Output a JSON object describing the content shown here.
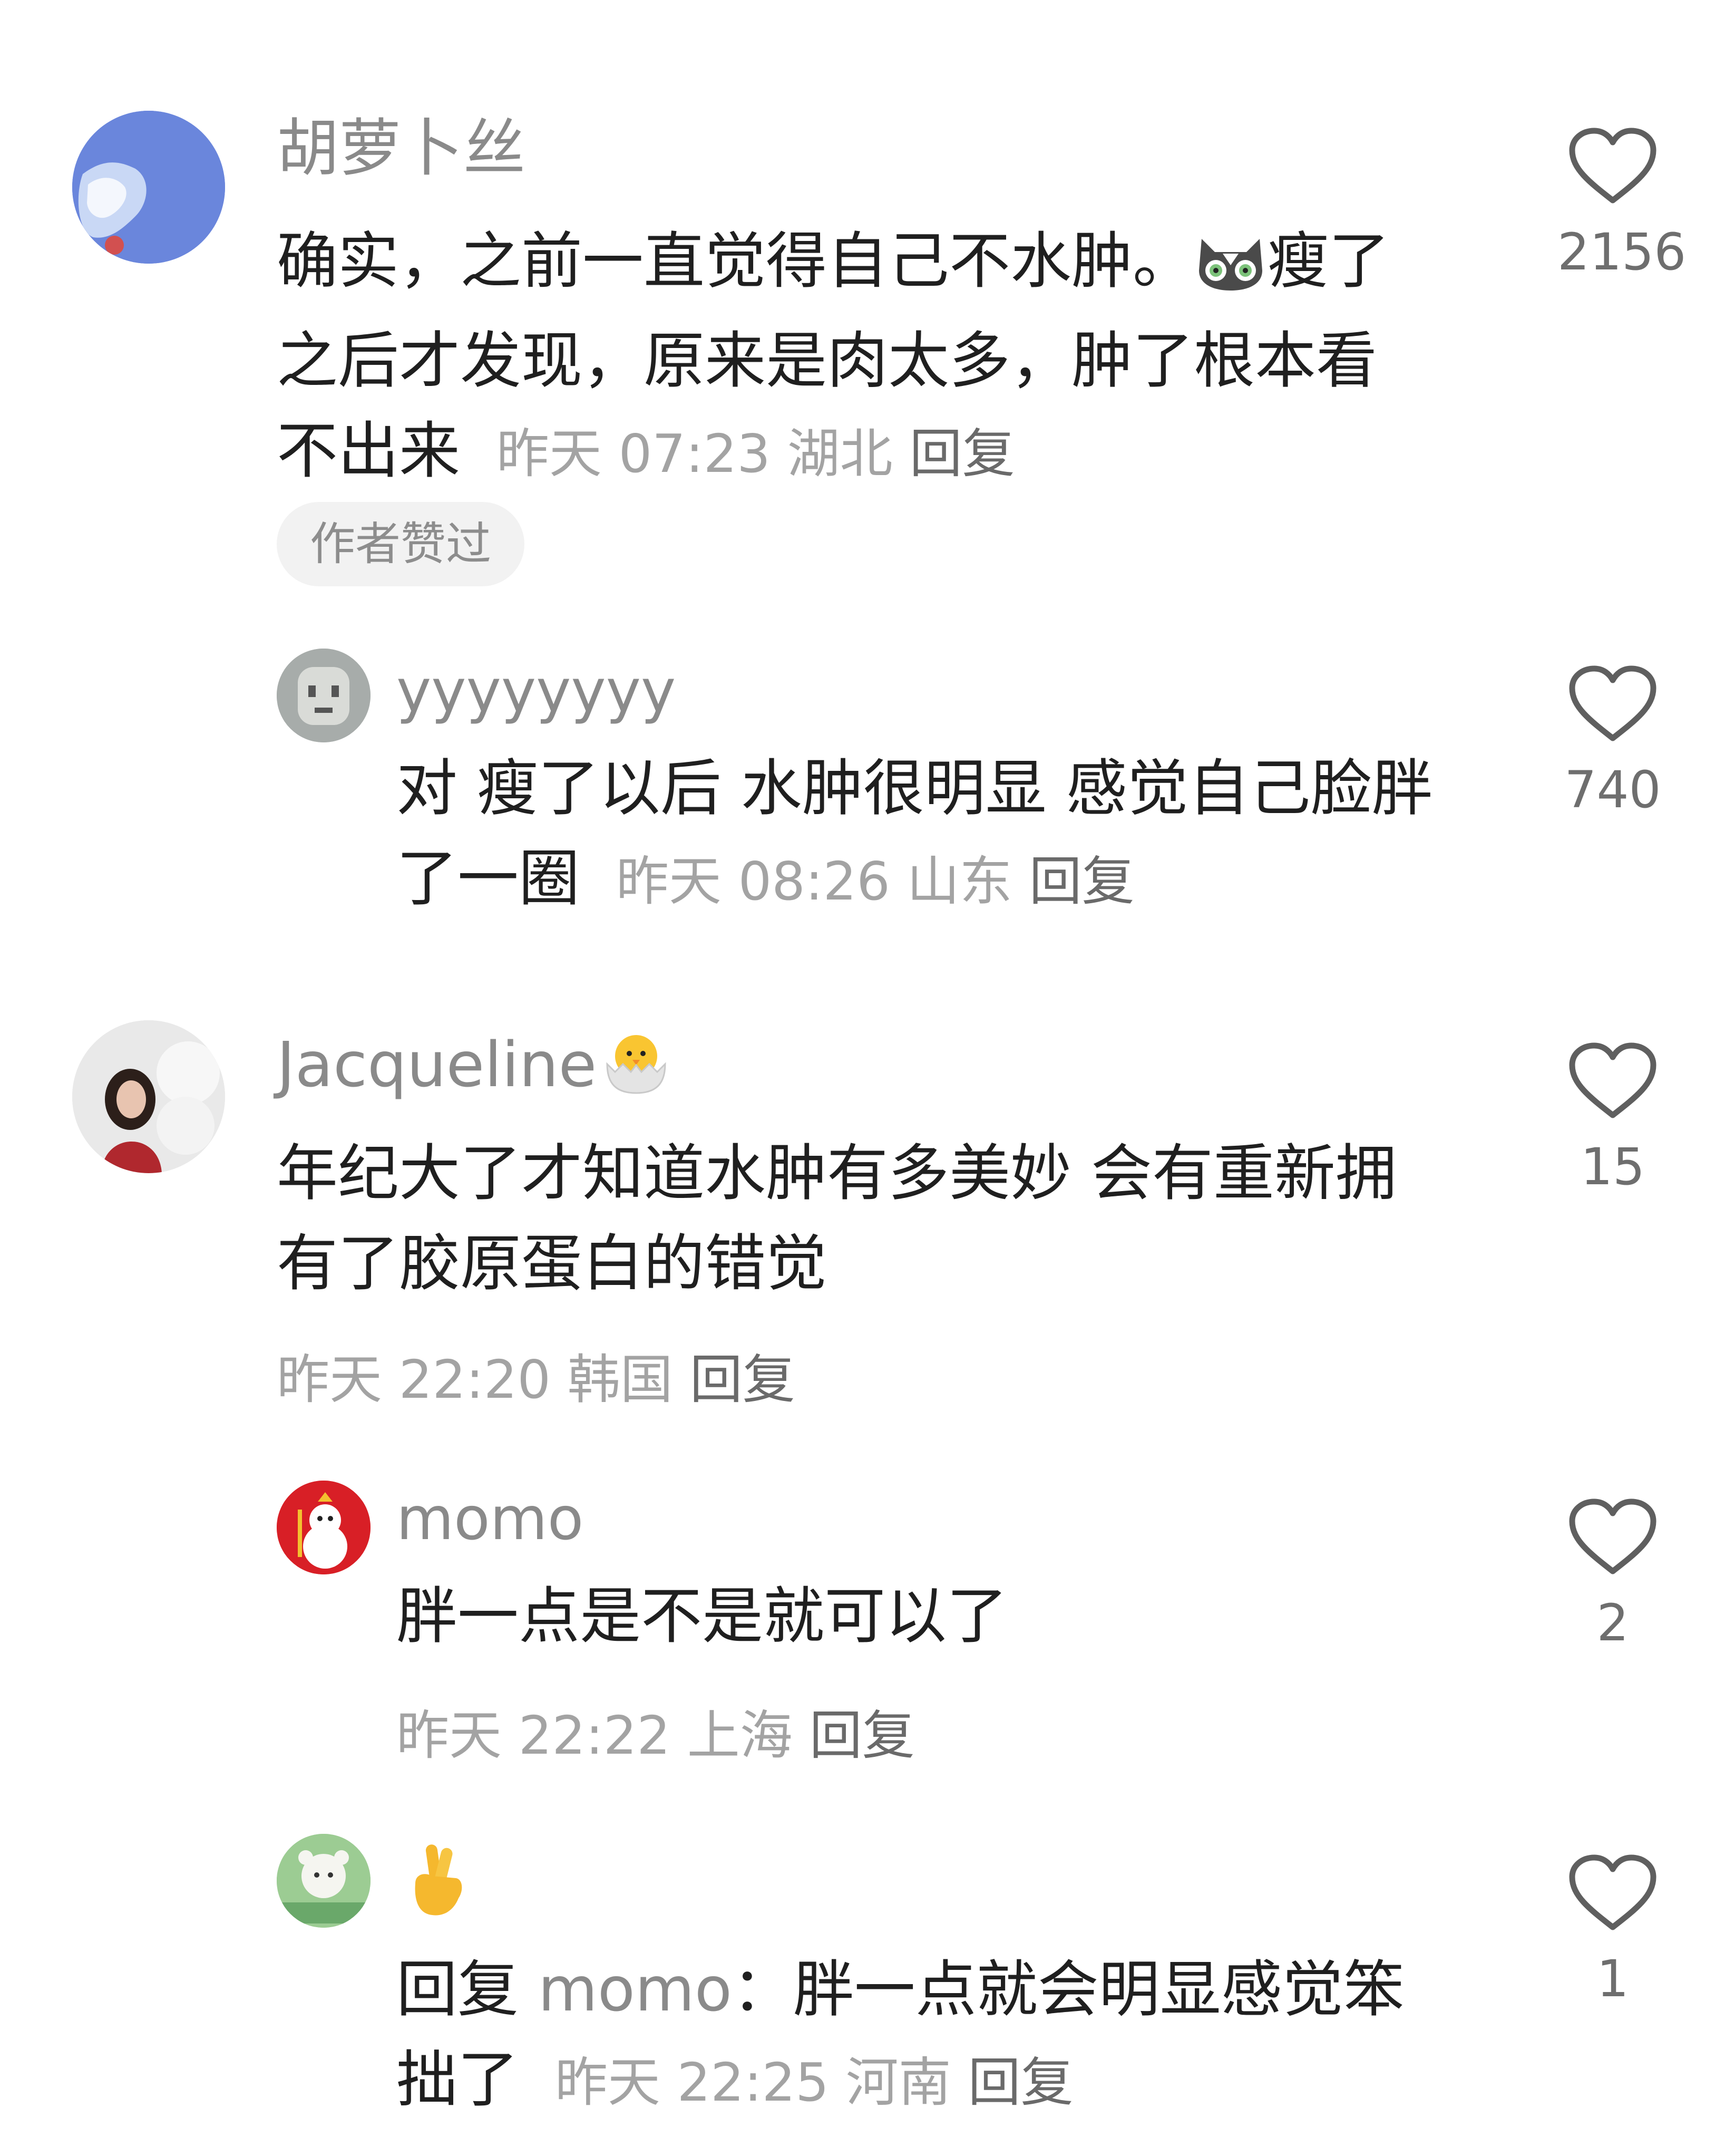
{
  "comments": [
    {
      "username": "胡萝卜丝",
      "text": "确实，之前一直觉得自己不水肿。",
      "text_after_emoji": "瘦了之后才发现，原来是肉太多，肿了根本看不出来",
      "emoji": "cat-face-icon",
      "time": "昨天 07:23",
      "location": "湖北",
      "reply_label": "回复",
      "badge": "作者赞过",
      "likes": "2156",
      "avatar": "blue-abstract-avatar"
    },
    {
      "username": "yyyyyyyy",
      "text": "对 瘦了以后 水肿很明显 感觉自己脸胖了一圈",
      "time": "昨天 08:26",
      "location": "山东",
      "reply_label": "回复",
      "likes": "740",
      "avatar": "grey-face-avatar"
    },
    {
      "username": "Jacqueline",
      "username_emoji": "hatching-chick-icon",
      "text": "年纪大了才知道水肿有多美妙 会有重新拥有了胶原蛋白的错觉",
      "time": "昨天 22:20",
      "location": "韩国",
      "reply_label": "回复",
      "likes": "15",
      "avatar": "person-photo-avatar"
    },
    {
      "username": "momo",
      "text": "胖一点是不是就可以了",
      "time": "昨天 22:22",
      "location": "上海",
      "reply_label": "回复",
      "likes": "2",
      "avatar": "snowman-avatar"
    },
    {
      "username_emoji": "crossed-fingers-icon",
      "reply_prefix": "回复",
      "reply_to": "momo",
      "text": "：胖一点就会明显感觉笨拙了",
      "time": "昨天 22:25",
      "location": "河南",
      "reply_label": "回复",
      "likes": "1",
      "avatar": "green-bear-avatar"
    }
  ],
  "colors": {
    "username": "#8a8a8a",
    "text": "#1f1f1f",
    "meta": "#a3a3a3",
    "badge_bg": "#f2f2f2",
    "like_icon": "#5f5f5f"
  }
}
